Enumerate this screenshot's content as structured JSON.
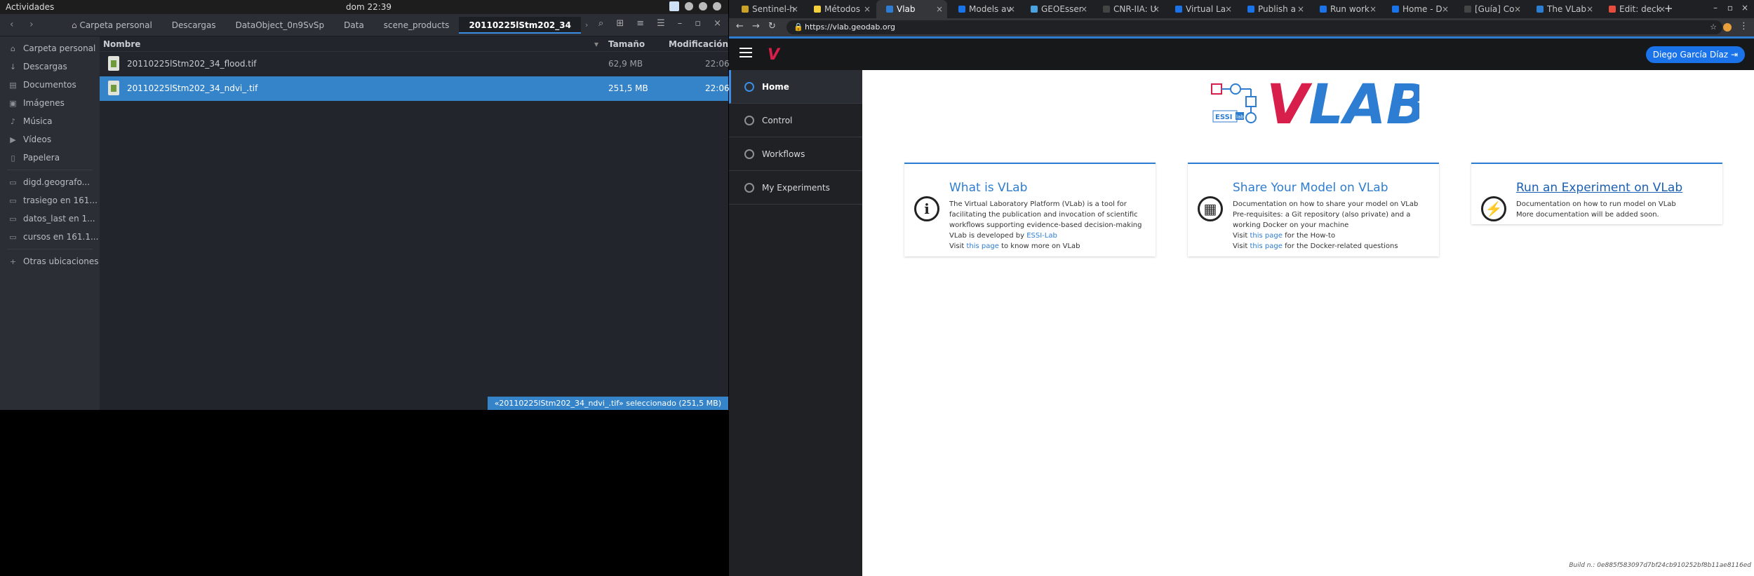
{
  "topbar": {
    "activities": "Actividades",
    "clock": "dom 22:39"
  },
  "nautilus": {
    "breadcrumbs": [
      "Carpeta personal",
      "Descargas",
      "DataObject_0n9SvSp",
      "Data",
      "scene_products",
      "20110225lStm202_34"
    ],
    "sidebar": [
      {
        "label": "Carpeta personal",
        "icon": "home-icon",
        "glyph": "⌂"
      },
      {
        "label": "Descargas",
        "icon": "download-icon",
        "glyph": "↓"
      },
      {
        "label": "Documentos",
        "icon": "document-icon",
        "glyph": "▤"
      },
      {
        "label": "Imágenes",
        "icon": "image-icon",
        "glyph": "▣"
      },
      {
        "label": "Música",
        "icon": "music-icon",
        "glyph": "♪"
      },
      {
        "label": "Vídeos",
        "icon": "video-icon",
        "glyph": "▶"
      },
      {
        "label": "Papelera",
        "icon": "trash-icon",
        "glyph": "▯"
      },
      {
        "label": "digd.geografo...",
        "icon": "network-drive-icon",
        "glyph": "▭"
      },
      {
        "label": "trasiego en 161...",
        "icon": "network-drive-icon",
        "glyph": "▭"
      },
      {
        "label": "datos_last en 1...",
        "icon": "network-drive-icon",
        "glyph": "▭"
      },
      {
        "label": "cursos en 161.1...",
        "icon": "network-drive-icon",
        "glyph": "▭"
      },
      {
        "label": "Otras ubicaciones",
        "icon": "plus-icon",
        "glyph": "+"
      }
    ],
    "columns": {
      "name": "Nombre",
      "size": "Tamaño",
      "modified": "Modificación"
    },
    "files": [
      {
        "name": "20110225lStm202_34_flood.tif",
        "size": "62,9 MB",
        "modified": "22:06",
        "selected": false
      },
      {
        "name": "20110225lStm202_34_ndvi_.tif",
        "size": "251,5 MB",
        "modified": "22:06",
        "selected": true
      }
    ],
    "status": "«20110225lStm202_34_ndvi_.tif» seleccionado  (251,5 MB)"
  },
  "chrome": {
    "tabs": [
      {
        "title": "Sentinel-h",
        "color": "#c9a227",
        "active": false
      },
      {
        "title": "Métodos",
        "color": "#f4d03f",
        "active": false
      },
      {
        "title": "Vlab",
        "color": "#2d7dd2",
        "active": true
      },
      {
        "title": "Models av",
        "color": "#1a73e8",
        "active": false
      },
      {
        "title": "GEOEsser",
        "color": "#4aa3df",
        "active": false
      },
      {
        "title": "CNR-IIA: U",
        "color": "#444444",
        "active": false
      },
      {
        "title": "Virtual La",
        "color": "#1a73e8",
        "active": false
      },
      {
        "title": "Publish a",
        "color": "#1a73e8",
        "active": false
      },
      {
        "title": "Run work",
        "color": "#1a73e8",
        "active": false
      },
      {
        "title": "Home - D",
        "color": "#1a73e8",
        "active": false
      },
      {
        "title": "[Guía] Co",
        "color": "#444444",
        "active": false
      },
      {
        "title": "The VLab",
        "color": "#2d7dd2",
        "active": false
      },
      {
        "title": "Edit: deck",
        "color": "#e74c3c",
        "active": false
      }
    ],
    "url": "https://vlab.geodab.org"
  },
  "vlab": {
    "user": "Diego García Díaz",
    "nav": [
      {
        "label": "Home",
        "icon": "home-icon",
        "active": true
      },
      {
        "label": "Control",
        "icon": "control-icon",
        "active": false
      },
      {
        "label": "Workflows",
        "icon": "workflows-icon",
        "active": false
      },
      {
        "label": "My Experiments",
        "icon": "experiments-icon",
        "active": false
      }
    ],
    "logo": {
      "word": "VLAB",
      "badge": "ESSI",
      "badge2": "lab"
    },
    "cards": [
      {
        "title": "What is VLab",
        "icon": "info-icon",
        "lines": [
          "The Virtual Laboratory Platform (VLab) is a tool for facilitating the publication and invocation of scientific workflows supporting evidence-based decision-making",
          "VLab is developed by",
          "ESSI-Lab",
          "Visit",
          "this page",
          "to know more on VLab"
        ]
      },
      {
        "title": "Share Your Model on VLab",
        "icon": "cubes-icon",
        "lines": [
          "Documentation on how to share your model on VLab",
          "Pre-requisites: a Git repository (also private) and a working Docker on your machine",
          "Visit",
          "this page",
          "for the How-to",
          "Visit",
          "this page",
          "for the Docker-related questions"
        ]
      },
      {
        "title": "Run an Experiment on VLab",
        "icon": "lightning-icon",
        "lines": [
          "Documentation on how to run model on VLab",
          "More documentation will be added soon."
        ]
      }
    ],
    "build": "Build n.: 0e885f583097d7bf24cb910252bf8b11ae8116ed"
  }
}
